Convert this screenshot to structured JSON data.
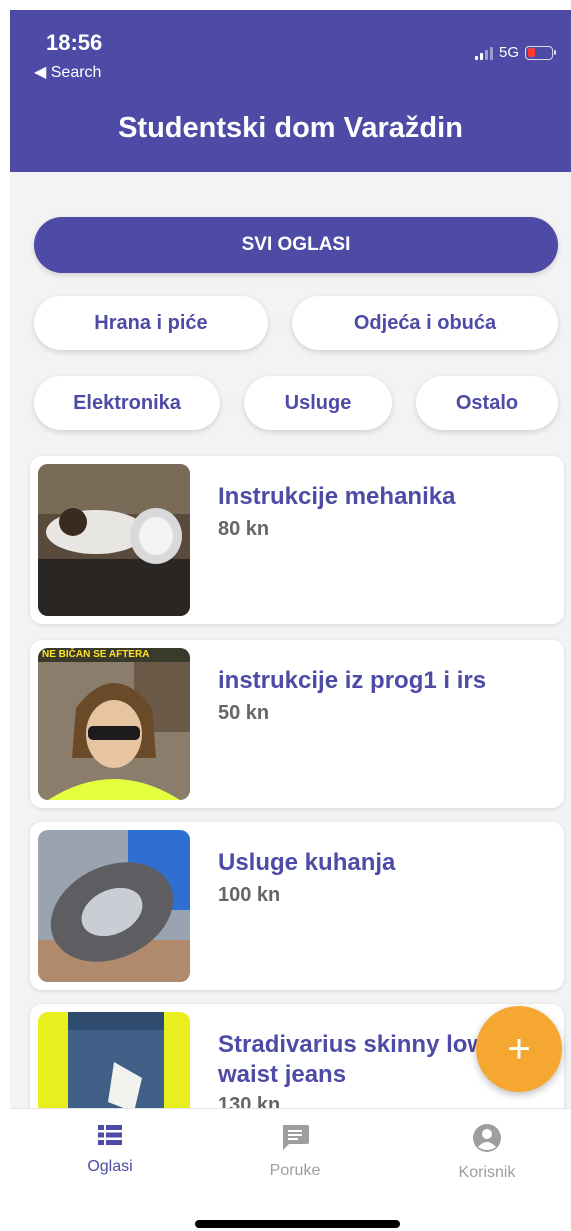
{
  "status_bar": {
    "time": "18:56",
    "back_label": "◀ Search",
    "network": "5G"
  },
  "header": {
    "title": "Studentski dom Varaždin"
  },
  "categories": {
    "all": "SVI OGLASI",
    "food": "Hrana i piće",
    "clothes": "Odjeća i obuća",
    "electronics": "Elektronika",
    "services": "Usluge",
    "other": "Ostalo"
  },
  "listings": [
    {
      "title": "Instrukcije mehanika",
      "price": "80 kn"
    },
    {
      "title": "instrukcije iz prog1 i irs",
      "price": "50 kn",
      "image_caption": "NE BIČAN SE AFTERA"
    },
    {
      "title": "Usluge kuhanja",
      "price": "100 kn"
    },
    {
      "title": "Stradivarius skinny low waist jeans",
      "price": "130 kn"
    }
  ],
  "fab": {
    "label": "+"
  },
  "bottom_nav": [
    {
      "label": "Oglasi",
      "active": true
    },
    {
      "label": "Poruke",
      "active": false
    },
    {
      "label": "Korisnik",
      "active": false
    }
  ],
  "colors": {
    "primary": "#4d4ba5",
    "accent": "#f5a732",
    "inactive": "#9e9e9e"
  }
}
